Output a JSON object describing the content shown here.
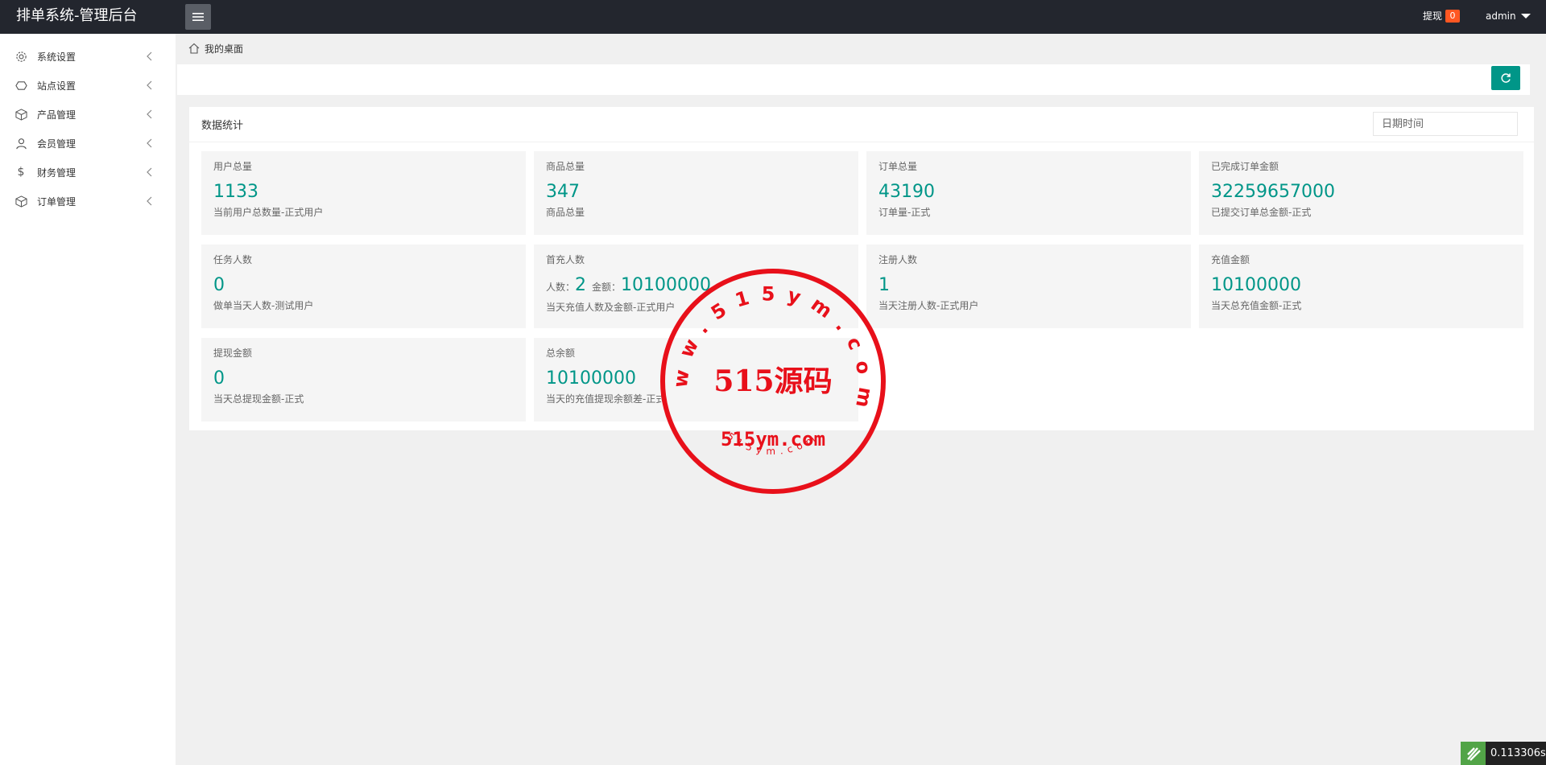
{
  "header": {
    "app_title": "排单系统-管理后台",
    "withdraw_label": "提现",
    "withdraw_count": "0",
    "user_label": "admin"
  },
  "sidebar": {
    "items": [
      {
        "label": "系统设置",
        "icon": "gear-icon"
      },
      {
        "label": "站点设置",
        "icon": "site-icon"
      },
      {
        "label": "产品管理",
        "icon": "box-icon"
      },
      {
        "label": "会员管理",
        "icon": "user-icon"
      },
      {
        "label": "财务管理",
        "icon": "dollar-icon"
      },
      {
        "label": "订单管理",
        "icon": "box-icon"
      }
    ]
  },
  "breadcrumb": {
    "label": "我的桌面"
  },
  "stats": {
    "title": "数据统计",
    "date_placeholder": "日期时间",
    "tiles": [
      {
        "label": "用户总量",
        "value": "1133",
        "desc": "当前用户总数量-正式用户"
      },
      {
        "label": "商品总量",
        "value": "347",
        "desc": "商品总量"
      },
      {
        "label": "订单总量",
        "value": "43190",
        "desc": "订单量-正式"
      },
      {
        "label": "已完成订单金额",
        "value": "32259657000",
        "desc": "已提交订单总金额-正式"
      },
      {
        "label": "任务人数",
        "value": "0",
        "desc": "做单当天人数-测试用户"
      },
      {
        "label": "首充人数",
        "people_label": "人数：",
        "people_value": "2",
        "amount_label": "金额：",
        "amount_value": "10100000",
        "desc": "当天充值人数及金额-正式用户"
      },
      {
        "label": "注册人数",
        "value": "1",
        "desc": "当天注册人数-正式用户"
      },
      {
        "label": "充值金额",
        "value": "10100000",
        "desc": "当天总充值金额-正式"
      },
      {
        "label": "提现金额",
        "value": "0",
        "desc": "当天总提现金额-正式"
      },
      {
        "label": "总余额",
        "value": "10100000",
        "desc": "当天的充值提现余额差-正式"
      }
    ]
  },
  "watermark": {
    "ring_text": "www.515ym.com",
    "center_text": "515源码",
    "domain_text": "515ym.com",
    "bottom_text": "515ym.com"
  },
  "timer": {
    "value": "0.113306s"
  },
  "colors": {
    "accent": "#009688",
    "topbar": "#23262e",
    "badge": "#ff5722",
    "stamp": "#e8101a"
  }
}
